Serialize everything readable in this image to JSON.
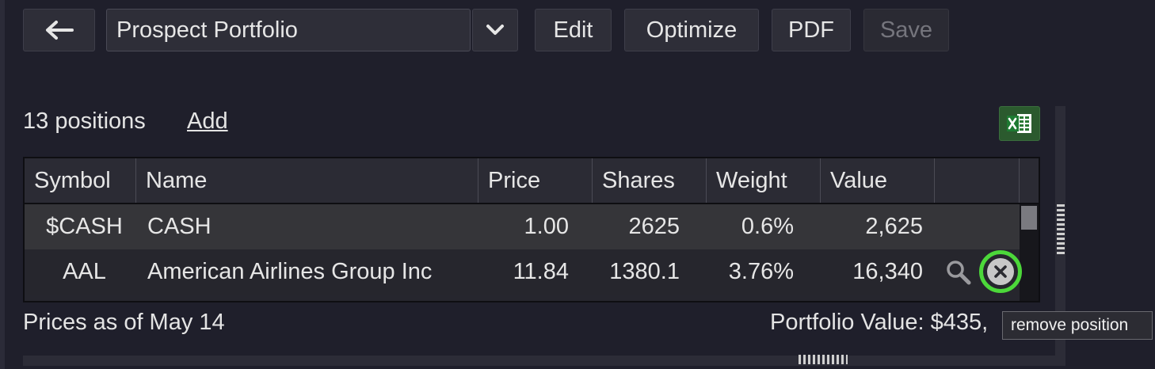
{
  "toolbar": {
    "back_icon": "arrow-left-icon",
    "portfolio_name": "Prospect Portfolio",
    "dropdown_icon": "chevron-down-icon",
    "edit_label": "Edit",
    "optimize_label": "Optimize",
    "pdf_label": "PDF",
    "save_label": "Save"
  },
  "positions": {
    "count_label": "13 positions",
    "add_label": "Add",
    "export_icon": "excel-icon"
  },
  "table": {
    "columns": [
      "Symbol",
      "Name",
      "Price",
      "Shares",
      "Weight",
      "Value"
    ],
    "rows": [
      {
        "symbol": "$CASH",
        "name": "CASH",
        "price": "1.00",
        "shares": "2625",
        "weight": "0.6%",
        "value": "2,625"
      },
      {
        "symbol": "AAL",
        "name": "American Airlines Group Inc",
        "price": "11.84",
        "shares": "1380.1",
        "weight": "3.76%",
        "value": "16,340"
      }
    ]
  },
  "footer": {
    "prices_as_of": "Prices as of May 14",
    "portfolio_value": "Portfolio Value: $435,"
  },
  "tooltip": {
    "text": "remove position"
  },
  "colors": {
    "background": "#1f1f2b",
    "highlight_ring": "#4cd83a",
    "excel_green": "#2b5a2e"
  }
}
